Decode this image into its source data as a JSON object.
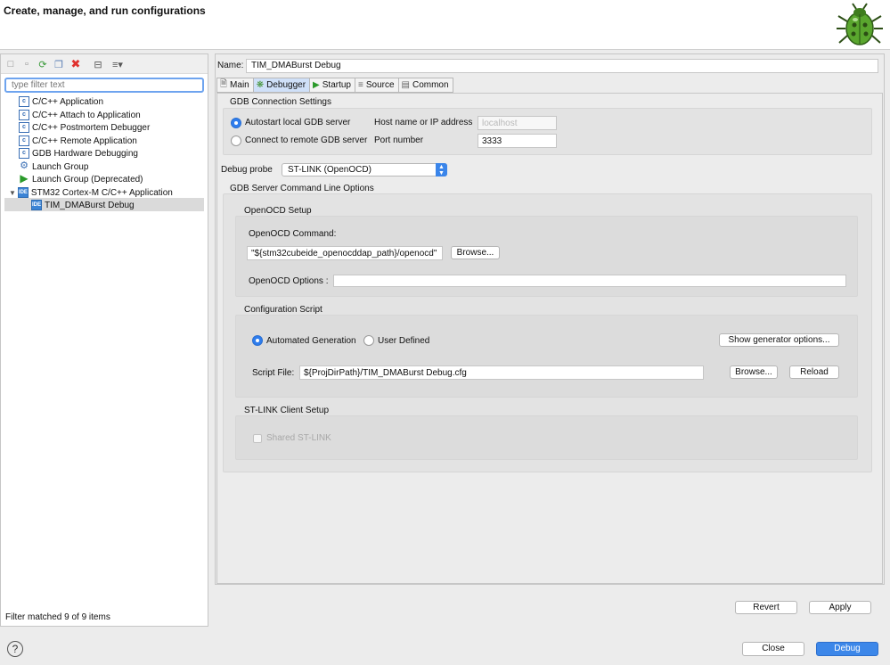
{
  "header": {
    "title": "Create, manage, and run configurations",
    "icon": "bug-icon"
  },
  "left": {
    "toolbar_icons": [
      "new-config-icon",
      "new-prototype-icon",
      "export-icon",
      "duplicate-icon",
      "delete-icon",
      "collapse-all-icon",
      "filter-icon"
    ],
    "filter_placeholder": "type filter text",
    "tree": [
      {
        "label": "C/C++ Application",
        "icon": "c-app-icon"
      },
      {
        "label": "C/C++ Attach to Application",
        "icon": "c-app-icon"
      },
      {
        "label": "C/C++ Postmortem Debugger",
        "icon": "c-app-icon"
      },
      {
        "label": "C/C++ Remote Application",
        "icon": "c-app-icon"
      },
      {
        "label": "GDB Hardware Debugging",
        "icon": "c-app-icon"
      },
      {
        "label": "Launch Group",
        "icon": "launch-group-icon"
      },
      {
        "label": "Launch Group (Deprecated)",
        "icon": "launch-arrow-icon"
      },
      {
        "label": "STM32 Cortex-M C/C++ Application",
        "icon": "ide-icon"
      },
      {
        "label": "TIM_DMABurst Debug",
        "icon": "ide-icon"
      }
    ],
    "status": "Filter matched 9 of 9 items"
  },
  "right": {
    "name_label": "Name:",
    "name_value": "TIM_DMABurst Debug",
    "tabs": [
      {
        "label": "Main",
        "icon": "main-tab-icon"
      },
      {
        "label": "Debugger",
        "icon": "debugger-tab-icon"
      },
      {
        "label": "Startup",
        "icon": "startup-tab-icon"
      },
      {
        "label": "Source",
        "icon": "source-tab-icon"
      },
      {
        "label": "Common",
        "icon": "common-tab-icon"
      }
    ],
    "active_tab": "Debugger",
    "gdb": {
      "title": "GDB Connection Settings",
      "autostart_label": "Autostart local GDB server",
      "connect_label": "Connect to remote GDB server",
      "host_label": "Host name or IP address",
      "host_value": "localhost",
      "port_label": "Port number",
      "port_value": "3333"
    },
    "probe_label": "Debug probe",
    "probe_value": "ST-LINK (OpenOCD)",
    "server_title": "GDB Server Command Line Options",
    "openocd": {
      "title": "OpenOCD Setup",
      "command_label": "OpenOCD Command:",
      "command_value": "\"${stm32cubeide_openocddap_path}/openocd\"",
      "browse_label": "Browse...",
      "options_label": "OpenOCD Options :",
      "options_value": ""
    },
    "script": {
      "title": "Configuration Script",
      "auto_label": "Automated Generation",
      "user_label": "User Defined",
      "show_options_label": "Show generator options...",
      "file_label": "Script File:",
      "file_value": "${ProjDirPath}/TIM_DMABurst Debug.cfg",
      "browse_label": "Browse...",
      "reload_label": "Reload"
    },
    "stlink": {
      "title": "ST-LINK Client Setup",
      "shared_label": "Shared ST-LINK"
    },
    "revert_label": "Revert",
    "apply_label": "Apply"
  },
  "footer": {
    "close_label": "Close",
    "debug_label": "Debug",
    "help_icon": "help-icon"
  }
}
